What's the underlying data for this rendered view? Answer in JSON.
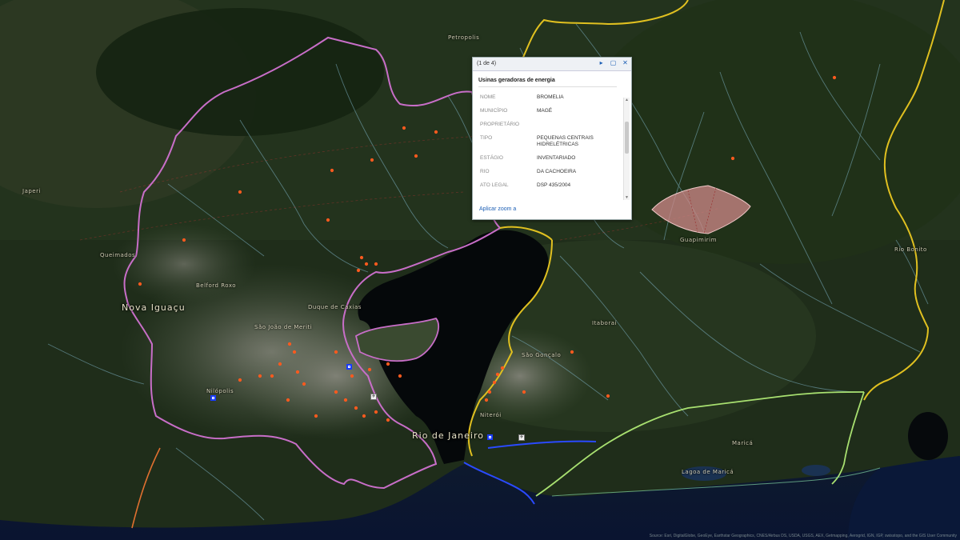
{
  "popup": {
    "counter": "(1 de 4)",
    "next_icon": "play-next-icon",
    "maximize_icon": "maximize-icon",
    "close_icon": "close-icon",
    "title": "Usinas geradoras de energia",
    "fields": [
      {
        "label": "NOME",
        "value": "BROMÉLIA"
      },
      {
        "label": "MUNICÍPIO",
        "value": "MAGÉ"
      },
      {
        "label": "PROPRIETÁRIO",
        "value": ""
      },
      {
        "label": "TIPO",
        "value": "PEQUENAS CENTRAIS HIDRELÉTRICAS"
      },
      {
        "label": "ESTÁGIO",
        "value": "INVENTARIADO"
      },
      {
        "label": "RIO",
        "value": "DA CACHOEIRA"
      },
      {
        "label": "ATO LEGAL",
        "value": "DSP 435/2004"
      }
    ],
    "zoom_link": "Aplicar zoom a"
  },
  "places": {
    "petropolis": "Petropolis",
    "nova_iguacu": "Nova Iguaçu",
    "duque_de_caxias": "Duque de Caxias",
    "rio_de_janeiro": "Rio de Janeiro",
    "sao_joao_de_meriti": "São João de Meriti",
    "belford_roxo": "Belford Roxo",
    "queimados": "Queimados",
    "japeri": "Japeri",
    "sao_goncalo": "São Gonçalo",
    "niteroi": "Niterói",
    "itaborai": "Itaboraí",
    "marica": "Maricá",
    "rio_bonito": "Rio Bonito",
    "guapimirim": "Guapimirim",
    "nilopolis": "Nilópolis",
    "lagoa_de_marica": "Lagoa de Maricá"
  },
  "attribution": "Source: Esri, DigitalGlobe, GeoEye, Earthstar Geographics, CNES/Airbus DS, USDA, USGS, AEX, Getmapping, Aerogrid, IGN, IGP, swisstopo, and the GIS User Community",
  "colors": {
    "boundary_pink": "#c86ec8",
    "boundary_yellow": "#e0c020",
    "boundary_green": "#a8e070",
    "coast_blue": "#2a4aff",
    "river": "#7fb5c8",
    "point": "#ff5a1e",
    "marker_blue": "#1a3cff"
  }
}
